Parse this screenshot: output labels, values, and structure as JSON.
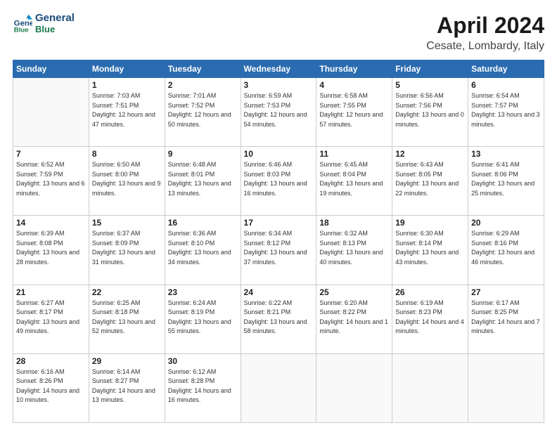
{
  "header": {
    "logo_line1": "General",
    "logo_line2": "Blue",
    "title": "April 2024",
    "subtitle": "Cesate, Lombardy, Italy"
  },
  "weekdays": [
    "Sunday",
    "Monday",
    "Tuesday",
    "Wednesday",
    "Thursday",
    "Friday",
    "Saturday"
  ],
  "weeks": [
    [
      {
        "day": "",
        "sunrise": "",
        "sunset": "",
        "daylight": ""
      },
      {
        "day": "1",
        "sunrise": "7:03 AM",
        "sunset": "7:51 PM",
        "daylight": "12 hours and 47 minutes."
      },
      {
        "day": "2",
        "sunrise": "7:01 AM",
        "sunset": "7:52 PM",
        "daylight": "12 hours and 50 minutes."
      },
      {
        "day": "3",
        "sunrise": "6:59 AM",
        "sunset": "7:53 PM",
        "daylight": "12 hours and 54 minutes."
      },
      {
        "day": "4",
        "sunrise": "6:58 AM",
        "sunset": "7:55 PM",
        "daylight": "12 hours and 57 minutes."
      },
      {
        "day": "5",
        "sunrise": "6:56 AM",
        "sunset": "7:56 PM",
        "daylight": "13 hours and 0 minutes."
      },
      {
        "day": "6",
        "sunrise": "6:54 AM",
        "sunset": "7:57 PM",
        "daylight": "13 hours and 3 minutes."
      }
    ],
    [
      {
        "day": "7",
        "sunrise": "6:52 AM",
        "sunset": "7:59 PM",
        "daylight": "13 hours and 6 minutes."
      },
      {
        "day": "8",
        "sunrise": "6:50 AM",
        "sunset": "8:00 PM",
        "daylight": "13 hours and 9 minutes."
      },
      {
        "day": "9",
        "sunrise": "6:48 AM",
        "sunset": "8:01 PM",
        "daylight": "13 hours and 13 minutes."
      },
      {
        "day": "10",
        "sunrise": "6:46 AM",
        "sunset": "8:03 PM",
        "daylight": "13 hours and 16 minutes."
      },
      {
        "day": "11",
        "sunrise": "6:45 AM",
        "sunset": "8:04 PM",
        "daylight": "13 hours and 19 minutes."
      },
      {
        "day": "12",
        "sunrise": "6:43 AM",
        "sunset": "8:05 PM",
        "daylight": "13 hours and 22 minutes."
      },
      {
        "day": "13",
        "sunrise": "6:41 AM",
        "sunset": "8:06 PM",
        "daylight": "13 hours and 25 minutes."
      }
    ],
    [
      {
        "day": "14",
        "sunrise": "6:39 AM",
        "sunset": "8:08 PM",
        "daylight": "13 hours and 28 minutes."
      },
      {
        "day": "15",
        "sunrise": "6:37 AM",
        "sunset": "8:09 PM",
        "daylight": "13 hours and 31 minutes."
      },
      {
        "day": "16",
        "sunrise": "6:36 AM",
        "sunset": "8:10 PM",
        "daylight": "13 hours and 34 minutes."
      },
      {
        "day": "17",
        "sunrise": "6:34 AM",
        "sunset": "8:12 PM",
        "daylight": "13 hours and 37 minutes."
      },
      {
        "day": "18",
        "sunrise": "6:32 AM",
        "sunset": "8:13 PM",
        "daylight": "13 hours and 40 minutes."
      },
      {
        "day": "19",
        "sunrise": "6:30 AM",
        "sunset": "8:14 PM",
        "daylight": "13 hours and 43 minutes."
      },
      {
        "day": "20",
        "sunrise": "6:29 AM",
        "sunset": "8:16 PM",
        "daylight": "13 hours and 46 minutes."
      }
    ],
    [
      {
        "day": "21",
        "sunrise": "6:27 AM",
        "sunset": "8:17 PM",
        "daylight": "13 hours and 49 minutes."
      },
      {
        "day": "22",
        "sunrise": "6:25 AM",
        "sunset": "8:18 PM",
        "daylight": "13 hours and 52 minutes."
      },
      {
        "day": "23",
        "sunrise": "6:24 AM",
        "sunset": "8:19 PM",
        "daylight": "13 hours and 55 minutes."
      },
      {
        "day": "24",
        "sunrise": "6:22 AM",
        "sunset": "8:21 PM",
        "daylight": "13 hours and 58 minutes."
      },
      {
        "day": "25",
        "sunrise": "6:20 AM",
        "sunset": "8:22 PM",
        "daylight": "14 hours and 1 minute."
      },
      {
        "day": "26",
        "sunrise": "6:19 AM",
        "sunset": "8:23 PM",
        "daylight": "14 hours and 4 minutes."
      },
      {
        "day": "27",
        "sunrise": "6:17 AM",
        "sunset": "8:25 PM",
        "daylight": "14 hours and 7 minutes."
      }
    ],
    [
      {
        "day": "28",
        "sunrise": "6:16 AM",
        "sunset": "8:26 PM",
        "daylight": "14 hours and 10 minutes."
      },
      {
        "day": "29",
        "sunrise": "6:14 AM",
        "sunset": "8:27 PM",
        "daylight": "14 hours and 13 minutes."
      },
      {
        "day": "30",
        "sunrise": "6:12 AM",
        "sunset": "8:28 PM",
        "daylight": "14 hours and 16 minutes."
      },
      {
        "day": "",
        "sunrise": "",
        "sunset": "",
        "daylight": ""
      },
      {
        "day": "",
        "sunrise": "",
        "sunset": "",
        "daylight": ""
      },
      {
        "day": "",
        "sunrise": "",
        "sunset": "",
        "daylight": ""
      },
      {
        "day": "",
        "sunrise": "",
        "sunset": "",
        "daylight": ""
      }
    ]
  ],
  "labels": {
    "sunrise_prefix": "Sunrise: ",
    "sunset_prefix": "Sunset: ",
    "daylight_prefix": "Daylight: "
  }
}
